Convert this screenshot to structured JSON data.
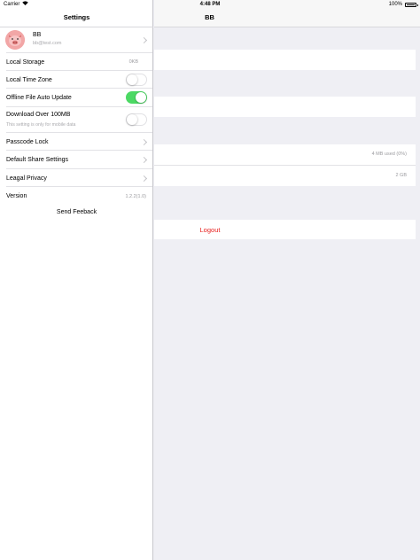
{
  "status_bar": {
    "carrier": "Carrier",
    "time": "4:48 PM",
    "battery": "100%"
  },
  "master": {
    "title": "Settings",
    "profile": {
      "name": "BB",
      "email": "bb@test.com"
    },
    "local_storage": {
      "label": "Local Storage",
      "value": "0KB"
    },
    "local_time_zone": {
      "label": "Local Time Zone",
      "on": false
    },
    "offline_auto_update": {
      "label": "Offline File Auto Update",
      "on": true
    },
    "download_over": {
      "label": "Download Over 100MB",
      "sublabel": "This setting is only for mobile data",
      "on": false
    },
    "passcode_lock": {
      "label": "Passcode Lock"
    },
    "default_share": {
      "label": "Default Share Settings"
    },
    "legal_privacy": {
      "label": "Leagal Privacy"
    },
    "version": {
      "label": "Version",
      "value": "1.2.2(1.0)"
    },
    "send_feedback": "Send Feeback"
  },
  "detail": {
    "title": "BB",
    "storage_used": "4 MB used (0%)",
    "storage_total": "2 GB",
    "logout": "Logout"
  },
  "colors": {
    "toggle_on": "#4cd964",
    "logout": "#e8211f",
    "background": "#efeff4"
  }
}
